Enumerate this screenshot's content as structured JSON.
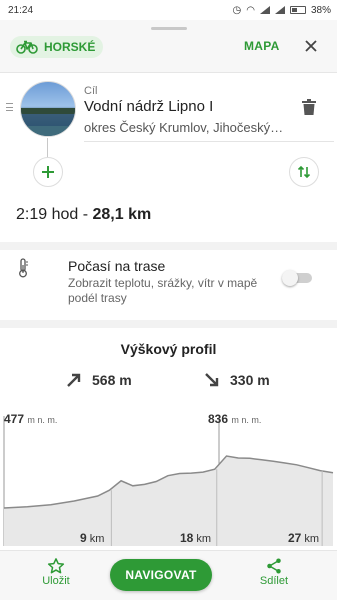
{
  "status_bar": {
    "time": "21:24",
    "battery": "38%"
  },
  "header": {
    "mode_label": "HORSKÉ",
    "map_button": "MAPA"
  },
  "destination": {
    "type_label": "Cíl",
    "name": "Vodní nádrž Lipno I",
    "subtitle": "okres Český Krumlov, Jihočeský…"
  },
  "summary": {
    "time": "2:19 hod",
    "separator": " - ",
    "distance": "28,1 km"
  },
  "weather": {
    "title": "Počasí na trase",
    "description": "Zobrazit teplotu, srážky, vítr v mapě podél trasy",
    "enabled": false
  },
  "profile": {
    "title": "Výškový profil",
    "ascent": "568 m",
    "descent": "330 m",
    "min_elevation": "477",
    "max_elevation": "836",
    "elevation_unit": "m n. m.",
    "km_markers": [
      {
        "value": "9",
        "unit": "km"
      },
      {
        "value": "18",
        "unit": "km"
      },
      {
        "value": "27",
        "unit": "km"
      }
    ]
  },
  "chart_data": {
    "type": "area",
    "x_unit": "km",
    "y_unit": "m n. m.",
    "x": [
      0,
      2,
      4,
      6,
      8,
      9,
      10,
      11,
      12,
      13,
      14,
      15,
      16,
      17,
      18,
      19,
      20,
      21,
      22,
      23,
      24,
      25,
      26,
      27,
      28.1
    ],
    "y": [
      477,
      485,
      500,
      525,
      560,
      600,
      665,
      630,
      640,
      660,
      700,
      715,
      718,
      725,
      745,
      836,
      822,
      820,
      810,
      800,
      788,
      775,
      755,
      735,
      720
    ],
    "xlim": [
      0,
      28.1
    ],
    "y_labels": [
      "477",
      "836"
    ]
  },
  "bottom_bar": {
    "save_label": "Uložit",
    "navigate_label": "NAVIGOVAT",
    "share_label": "Sdílet"
  },
  "colors": {
    "accent": "#2e9a36",
    "chip_bg": "#e3f3e3"
  },
  "icons": {
    "mode": "bicycle-icon",
    "close": "close-icon",
    "delete": "trash-icon",
    "add": "plus-icon",
    "swap": "swap-vertical-icon",
    "weather": "thermometer-icon",
    "ascent": "arrow-up-right-icon",
    "descent": "arrow-down-right-icon",
    "save": "star-icon",
    "share": "share-icon"
  }
}
